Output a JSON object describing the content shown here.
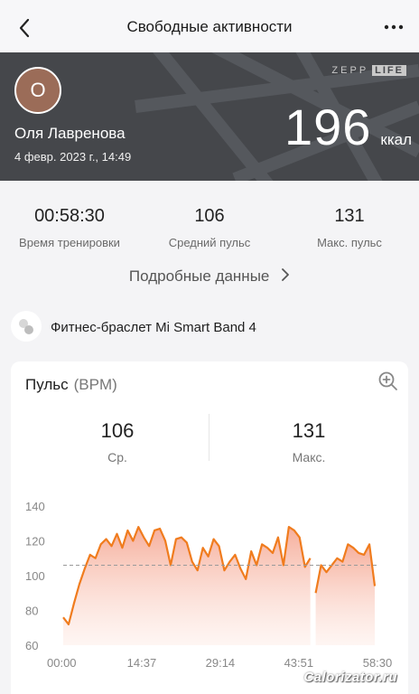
{
  "header": {
    "title": "Свободные активности",
    "back_icon": "chevron-left-icon",
    "more_icon": "more-dots-icon"
  },
  "banner": {
    "avatar_letter": "О",
    "user_name": "Оля Лавренова",
    "date": "4 февр. 2023 г., 14:49",
    "brand_zepp": "ZEPP",
    "brand_life": "LIFE",
    "calories": "196",
    "calories_unit": "ккал"
  },
  "stats": [
    {
      "value": "00:58:30",
      "label": "Время тренировки"
    },
    {
      "value": "106",
      "label": "Средний пульс"
    },
    {
      "value": "131",
      "label": "Макс. пульс"
    }
  ],
  "details_label": "Подробные данные",
  "device": {
    "name": "Фитнес-браслет Mi Smart Band 4",
    "icon": "device-icon"
  },
  "pulse": {
    "title": "Пульс",
    "unit": "(BPM)",
    "avg_value": "106",
    "avg_label": "Ср.",
    "max_value": "131",
    "max_label": "Макс."
  },
  "chart_data": {
    "type": "area",
    "ylim": [
      60,
      140
    ],
    "yticks": [
      "140",
      "120",
      "100",
      "80",
      "60"
    ],
    "xticks": [
      "00:00",
      "14:37",
      "29:14",
      "43:51",
      "58:30"
    ],
    "average_line": 106,
    "color": "#f07c1e",
    "x_minutes": [
      0,
      1,
      2,
      3,
      4,
      5,
      6,
      7,
      8,
      9,
      10,
      11,
      12,
      13,
      14,
      15,
      16,
      17,
      18,
      19,
      20,
      21,
      22,
      23,
      24,
      25,
      26,
      27,
      28,
      29,
      30,
      31,
      32,
      33,
      34,
      35,
      36,
      37,
      38,
      39,
      40,
      41,
      42,
      43,
      44,
      45,
      46,
      47,
      48,
      49,
      50,
      51,
      52,
      53,
      54,
      55,
      56,
      57,
      58
    ],
    "values": [
      76,
      72,
      84,
      95,
      104,
      112,
      110,
      118,
      121,
      117,
      124,
      116,
      126,
      120,
      128,
      122,
      117,
      126,
      127,
      120,
      106,
      121,
      122,
      119,
      108,
      103,
      116,
      111,
      121,
      117,
      103,
      108,
      112,
      104,
      98,
      114,
      106,
      118,
      116,
      113,
      122,
      106,
      128,
      126,
      122,
      105,
      110,
      90,
      106,
      102,
      106,
      110,
      108,
      118,
      116,
      113,
      112,
      118,
      94
    ],
    "gaps": [
      [
        20.8,
        21.2
      ],
      [
        41.6,
        42.2
      ],
      [
        46.4,
        46.8
      ]
    ]
  },
  "watermark": "Calorizator.ru"
}
